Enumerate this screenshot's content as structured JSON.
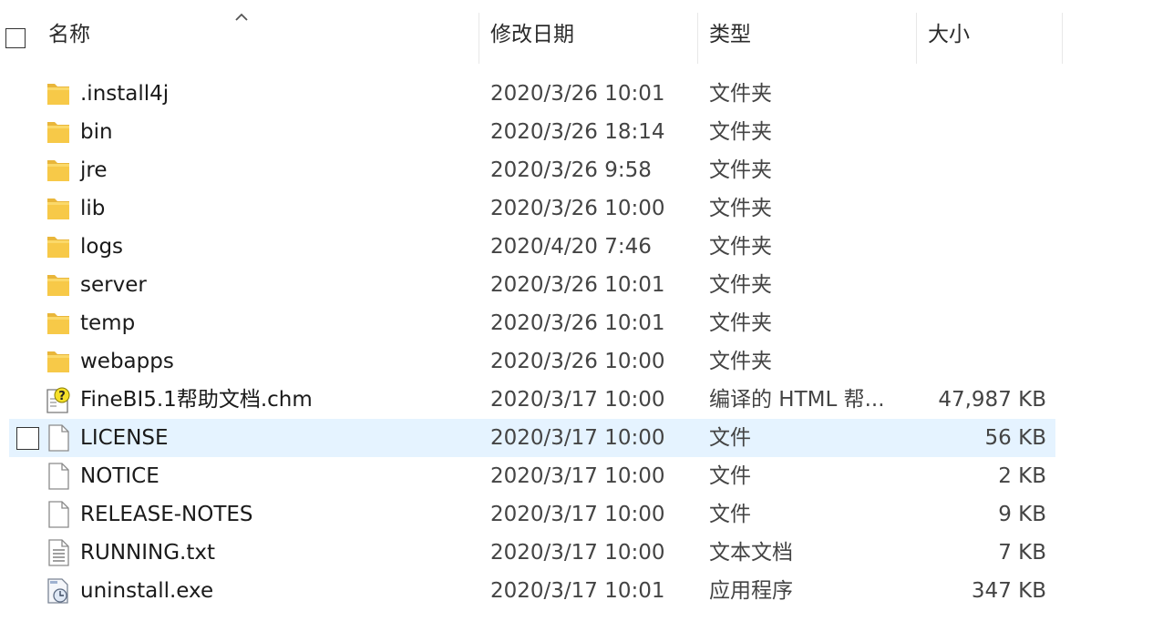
{
  "header": {
    "name_label": "名称",
    "date_label": "修改日期",
    "type_label": "类型",
    "size_label": "大小"
  },
  "files": [
    {
      "name": ".install4j",
      "date": "2020/3/26 10:01",
      "type": "文件夹",
      "size": "",
      "icon": "folder-icon"
    },
    {
      "name": "bin",
      "date": "2020/3/26 18:14",
      "type": "文件夹",
      "size": "",
      "icon": "folder-icon"
    },
    {
      "name": "jre",
      "date": "2020/3/26 9:58",
      "type": "文件夹",
      "size": "",
      "icon": "folder-icon"
    },
    {
      "name": "lib",
      "date": "2020/3/26 10:00",
      "type": "文件夹",
      "size": "",
      "icon": "folder-icon"
    },
    {
      "name": "logs",
      "date": "2020/4/20 7:46",
      "type": "文件夹",
      "size": "",
      "icon": "folder-icon"
    },
    {
      "name": "server",
      "date": "2020/3/26 10:01",
      "type": "文件夹",
      "size": "",
      "icon": "folder-icon"
    },
    {
      "name": "temp",
      "date": "2020/3/26 10:01",
      "type": "文件夹",
      "size": "",
      "icon": "folder-icon"
    },
    {
      "name": "webapps",
      "date": "2020/3/26 10:00",
      "type": "文件夹",
      "size": "",
      "icon": "folder-icon"
    },
    {
      "name": "FineBI5.1帮助文档.chm",
      "date": "2020/3/17 10:00",
      "type": "编译的 HTML 帮...",
      "size": "47,987 KB",
      "icon": "chm-help-icon"
    },
    {
      "name": "LICENSE",
      "date": "2020/3/17 10:00",
      "type": "文件",
      "size": "56 KB",
      "icon": "file-icon",
      "selected": true
    },
    {
      "name": "NOTICE",
      "date": "2020/3/17 10:00",
      "type": "文件",
      "size": "2 KB",
      "icon": "file-icon"
    },
    {
      "name": "RELEASE-NOTES",
      "date": "2020/3/17 10:00",
      "type": "文件",
      "size": "9 KB",
      "icon": "file-icon"
    },
    {
      "name": "RUNNING.txt",
      "date": "2020/3/17 10:00",
      "type": "文本文档",
      "size": "7 KB",
      "icon": "text-file-icon"
    },
    {
      "name": "uninstall.exe",
      "date": "2020/3/17 10:01",
      "type": "应用程序",
      "size": "347 KB",
      "icon": "exe-icon"
    }
  ],
  "colors": {
    "selection": "#e5f3ff",
    "folder": "#f7c948"
  }
}
